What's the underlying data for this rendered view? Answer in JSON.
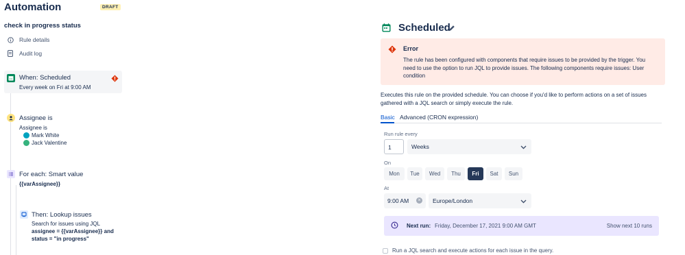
{
  "header": {
    "app_title": "Automation",
    "draft_badge": "DRAFT",
    "rule_name": "check in progress status"
  },
  "nav": {
    "items": [
      {
        "label": "Rule details",
        "icon": "info-icon"
      },
      {
        "label": "Audit log",
        "icon": "document-icon"
      }
    ]
  },
  "steps": {
    "trigger": {
      "title": "When: Scheduled",
      "subtitle": "Every week on Fri at 9:00 AM",
      "icon": "calendar-icon",
      "has_error": true
    },
    "condition": {
      "title": "Assignee is",
      "subtitle": "Assignee is",
      "users": [
        "Mark White",
        "Jack Valentine"
      ],
      "icon": "user-icon"
    },
    "branch": {
      "title": "For each: Smart value",
      "subtitle": "{{varAssignee}}",
      "icon": "list-icon"
    },
    "action": {
      "title": "Then: Lookup issues",
      "line1": "Search for issues using JQL",
      "line2": "assignee = {{varAssignee}} and",
      "line3": "status = \"in progress\"",
      "icon": "search-issue-icon"
    }
  },
  "detail": {
    "title": "Scheduled",
    "error": {
      "title": "Error",
      "body": "The rule has been configured with components that require issues to be provided by the trigger. You need to use the option to run JQL to provide issues. The following components require issues: User condition"
    },
    "description": "Executes this rule on the provided schedule. You can choose if you'd like to perform actions on a set of issues gathered with a JQL search or simply execute the rule.",
    "tabs": [
      {
        "label": "Basic",
        "active": true
      },
      {
        "label": "Advanced (CRON expression)",
        "active": false
      }
    ],
    "run_every_label": "Run rule every",
    "run_every_value": "1",
    "run_every_unit": "Weeks",
    "on_label": "On",
    "days": [
      {
        "label": "Mon",
        "selected": false
      },
      {
        "label": "Tue",
        "selected": false
      },
      {
        "label": "Wed",
        "selected": false
      },
      {
        "label": "Thu",
        "selected": false
      },
      {
        "label": "Fri",
        "selected": true
      },
      {
        "label": "Sat",
        "selected": false
      },
      {
        "label": "Sun",
        "selected": false
      }
    ],
    "at_label": "At",
    "time_value": "9:00 AM",
    "timezone": "Europe/London",
    "next_run_label": "Next run:",
    "next_run_value": "Friday, December 17, 2021 9:00 AM GMT",
    "show_next_label": "Show next 10 runs",
    "jql_checkbox_label": "Run a JQL search and execute actions for each issue in the query.",
    "jql_checked": false
  },
  "colors": {
    "accent": "#0052cc",
    "error_bg": "#ffebe6",
    "error_icon": "#de350b",
    "selected_day": "#253858",
    "next_run_bg": "#eae6ff",
    "trigger_icon": "#00875a"
  }
}
